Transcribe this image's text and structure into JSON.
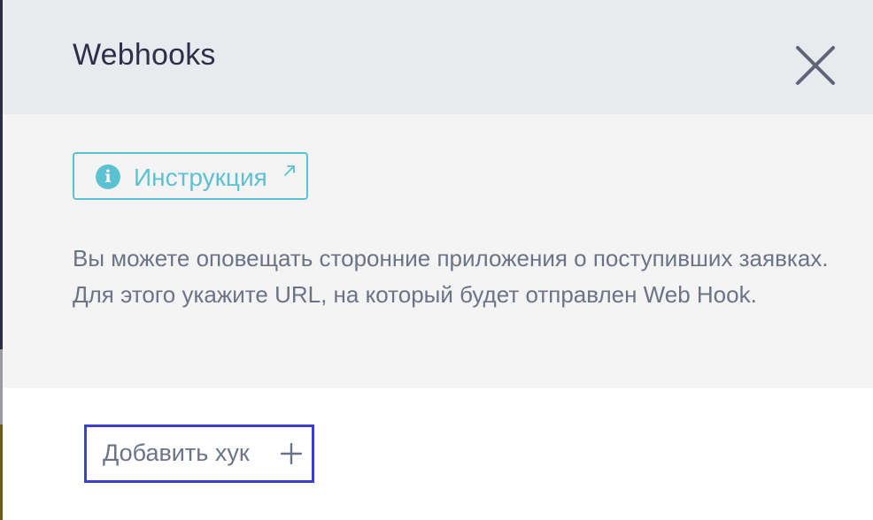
{
  "dialog": {
    "title": "Webhooks",
    "close_icon": "close-icon"
  },
  "instruction": {
    "label": "Инструкция",
    "info_icon": "info-icon",
    "info_glyph": "i",
    "external_icon": "external-link-icon",
    "accent_color": "#5cc2d3"
  },
  "description": {
    "text": "Вы можете оповещать сторонние приложения о поступивших заявках. Для этого укажите URL, на который будет отправлен Web Hook."
  },
  "add_hook": {
    "label": "Добавить хук",
    "plus_icon": "plus-icon",
    "focus_border_color": "#3a3fd0"
  }
}
